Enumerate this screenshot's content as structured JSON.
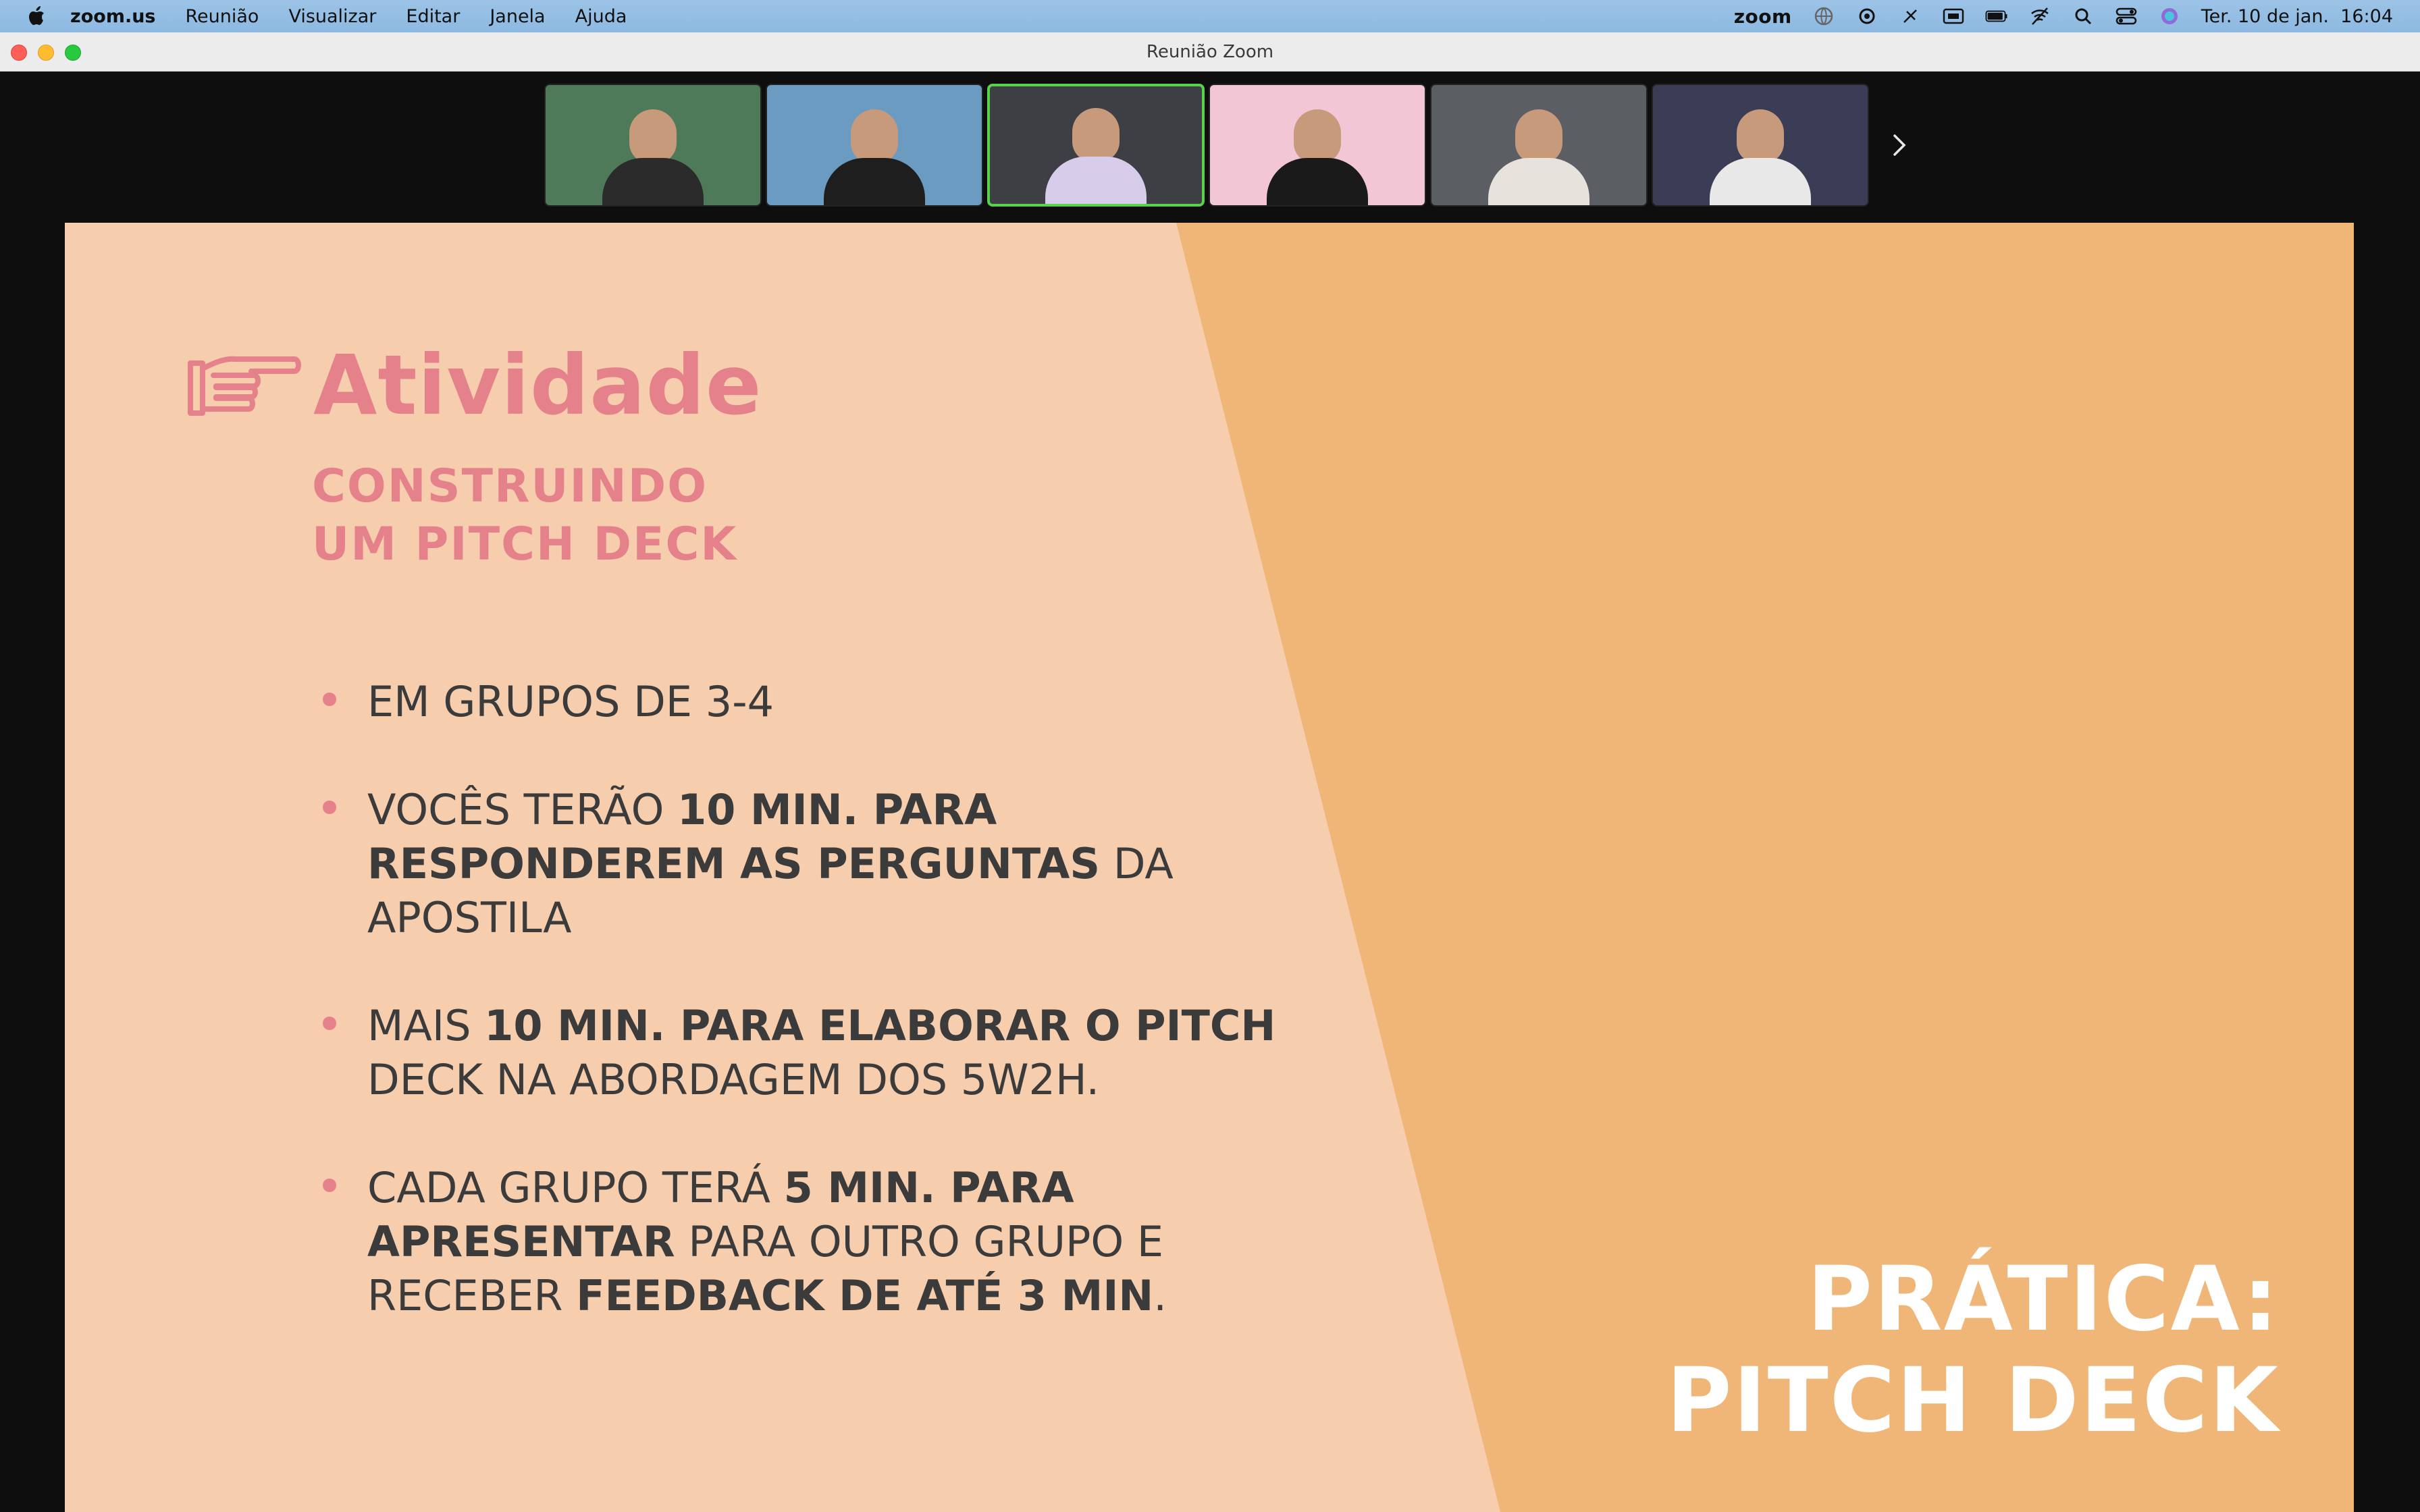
{
  "menubar": {
    "app_name": "zoom.us",
    "menus": [
      "Reunião",
      "Visualizar",
      "Editar",
      "Janela",
      "Ajuda"
    ],
    "status_zoom": "zoom",
    "datetime": "Ter. 10 de jan.  16:04"
  },
  "window": {
    "title": "Reunião Zoom"
  },
  "participants": [
    {
      "bg": "#4f7a5a",
      "shirt": "#2b2b2b"
    },
    {
      "bg": "#6b9bc0",
      "shirt": "#1e1e1e"
    },
    {
      "bg": "#3d3f45",
      "shirt": "#d7cdea"
    },
    {
      "bg": "#f2c6d4",
      "shirt": "#1a1a1a"
    },
    {
      "bg": "#5b5e63",
      "shirt": "#e8e2dc"
    },
    {
      "bg": "#3a3d55",
      "shirt": "#e8e8e8"
    }
  ],
  "slide": {
    "title": "Atividade",
    "subtitle_line1": "CONSTRUINDO",
    "subtitle_line2": "UM PITCH DECK",
    "bullets": [
      {
        "parts": [
          {
            "t": "EM GRUPOS DE 3-4",
            "b": false
          }
        ]
      },
      {
        "parts": [
          {
            "t": "VOCÊS TERÃO ",
            "b": false
          },
          {
            "t": "10 MIN. PARA RESPONDEREM AS PERGUNTAS",
            "b": true
          },
          {
            "t": " DA APOSTILA",
            "b": false
          }
        ]
      },
      {
        "parts": [
          {
            "t": "MAIS ",
            "b": false
          },
          {
            "t": "10 MIN. PARA ELABORAR O PITCH",
            "b": true
          },
          {
            "t": " DECK NA ABORDAGEM DOS 5W2H.",
            "b": false
          }
        ]
      },
      {
        "parts": [
          {
            "t": "CADA GRUPO TERÁ ",
            "b": false
          },
          {
            "t": "5 MIN. PARA APRESENTAR",
            "b": true
          },
          {
            "t": " PARA OUTRO GRUPO E RECEBER ",
            "b": false
          },
          {
            "t": "FEEDBACK DE ATÉ 3 MIN",
            "b": true
          },
          {
            "t": ".",
            "b": false
          }
        ]
      }
    ],
    "side_title_line1": "PRÁTICA:",
    "side_title_line2": "PITCH DECK",
    "colors": {
      "accent": "#e5818b",
      "light_bg": "#f6cdad",
      "dark_bg": "#efb678"
    }
  }
}
